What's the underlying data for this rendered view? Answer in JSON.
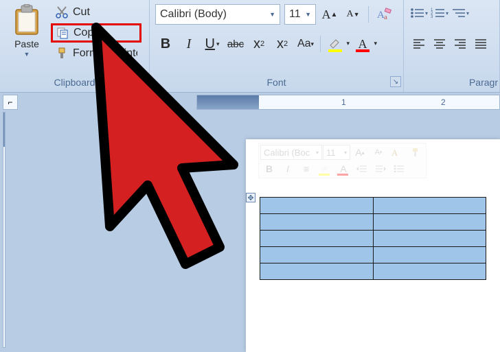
{
  "ribbon": {
    "clipboard": {
      "label": "Clipboard",
      "paste": "Paste",
      "cut": "Cut",
      "copy": "Copy",
      "format_painter": "Format Painter"
    },
    "font": {
      "label": "Font",
      "font_name": "Calibri (Body)",
      "font_size": "11"
    },
    "paragraph": {
      "label": "Paragr"
    }
  },
  "ruler": {
    "marks": [
      "1",
      "2"
    ]
  },
  "mini_toolbar": {
    "font_name": "Calibri (Boc",
    "font_size": "11"
  },
  "table": {
    "rows": 5,
    "cols": 2
  }
}
